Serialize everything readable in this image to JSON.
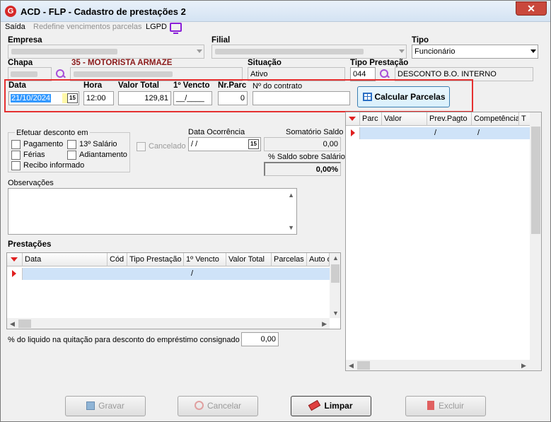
{
  "window": {
    "title": "ACD - FLP - Cadastro de prestações 2",
    "icon": "app-logo-icon",
    "close_icon": "close-icon",
    "close_glyph": "✕"
  },
  "menu": {
    "items": [
      {
        "label": "Saída"
      },
      {
        "label": "Redefine vencimentos parcelas"
      },
      {
        "label": "LGPD"
      }
    ]
  },
  "form": {
    "empresa_label": "Empresa",
    "filial_label": "Filial",
    "tipo_label": "Tipo",
    "tipo_value": "Funcionário",
    "chapa_label": "Chapa",
    "employee_name": "35 - MOTORISTA ARMAZE",
    "situacao_label": "Situação",
    "situacao_value": "Ativo",
    "tipo_prestacao_label": "Tipo Prestação",
    "tipo_prestacao_code": "044",
    "tipo_prestacao_desc": "DESCONTO B.O. INTERNO",
    "data_label": "Data",
    "data_value": "21/10/2024",
    "hora_label": "Hora",
    "hora_value": "12:00",
    "valor_total_label": "Valor Total",
    "valor_total_value": "129,81",
    "primeiro_vencto_label": "1º Vencto",
    "primeiro_vencto_value": "__/____",
    "nr_parc_label": "Nr.Parc",
    "nr_parc_value": "0",
    "contrato_label": "Nº do contrato",
    "contrato_value": "",
    "calcular_label": "Calcular Parcelas",
    "calendar_glyph": "15"
  },
  "desconto": {
    "title": "Efetuar desconto em",
    "options": [
      "Pagamento",
      "13º Salário",
      "Férias",
      "Adiantamento",
      "Recibo informado"
    ]
  },
  "cancelado_label": "Cancelado",
  "ocorrencia": {
    "label": "Data Ocorrência",
    "value": " /  /"
  },
  "saldo": {
    "somatorio_label": "Somatório Saldo",
    "somatorio_value": "0,00",
    "percent_label": "% Saldo sobre Salário",
    "percent_value": "0,00%"
  },
  "observacoes_label": "Observações",
  "prestacoes": {
    "label": "Prestações",
    "columns": [
      "Data",
      "Cód",
      "Tipo Prestação",
      "1º Vencto",
      "Valor Total",
      "Parcelas",
      "Auto d"
    ],
    "rows": [
      {
        "vencto": "/"
      }
    ]
  },
  "liquido": {
    "label": "% do liquido na quitação para desconto do empréstimo consignado",
    "value": "0,00"
  },
  "parcelas_grid": {
    "columns": [
      "Parc",
      "Valor",
      "Prev.Pagto",
      "Competência",
      "T"
    ],
    "rows": [
      {
        "prev": "/",
        "comp": "/"
      }
    ]
  },
  "buttons": {
    "gravar": "Gravar",
    "cancelar": "Cancelar",
    "limpar": "Limpar",
    "excluir": "Excluir"
  },
  "colors": {
    "accent_red": "#e53030",
    "row_select": "#cfe3f8",
    "icon_purple": "#a74fd8",
    "name_red": "#8b1a1a"
  }
}
